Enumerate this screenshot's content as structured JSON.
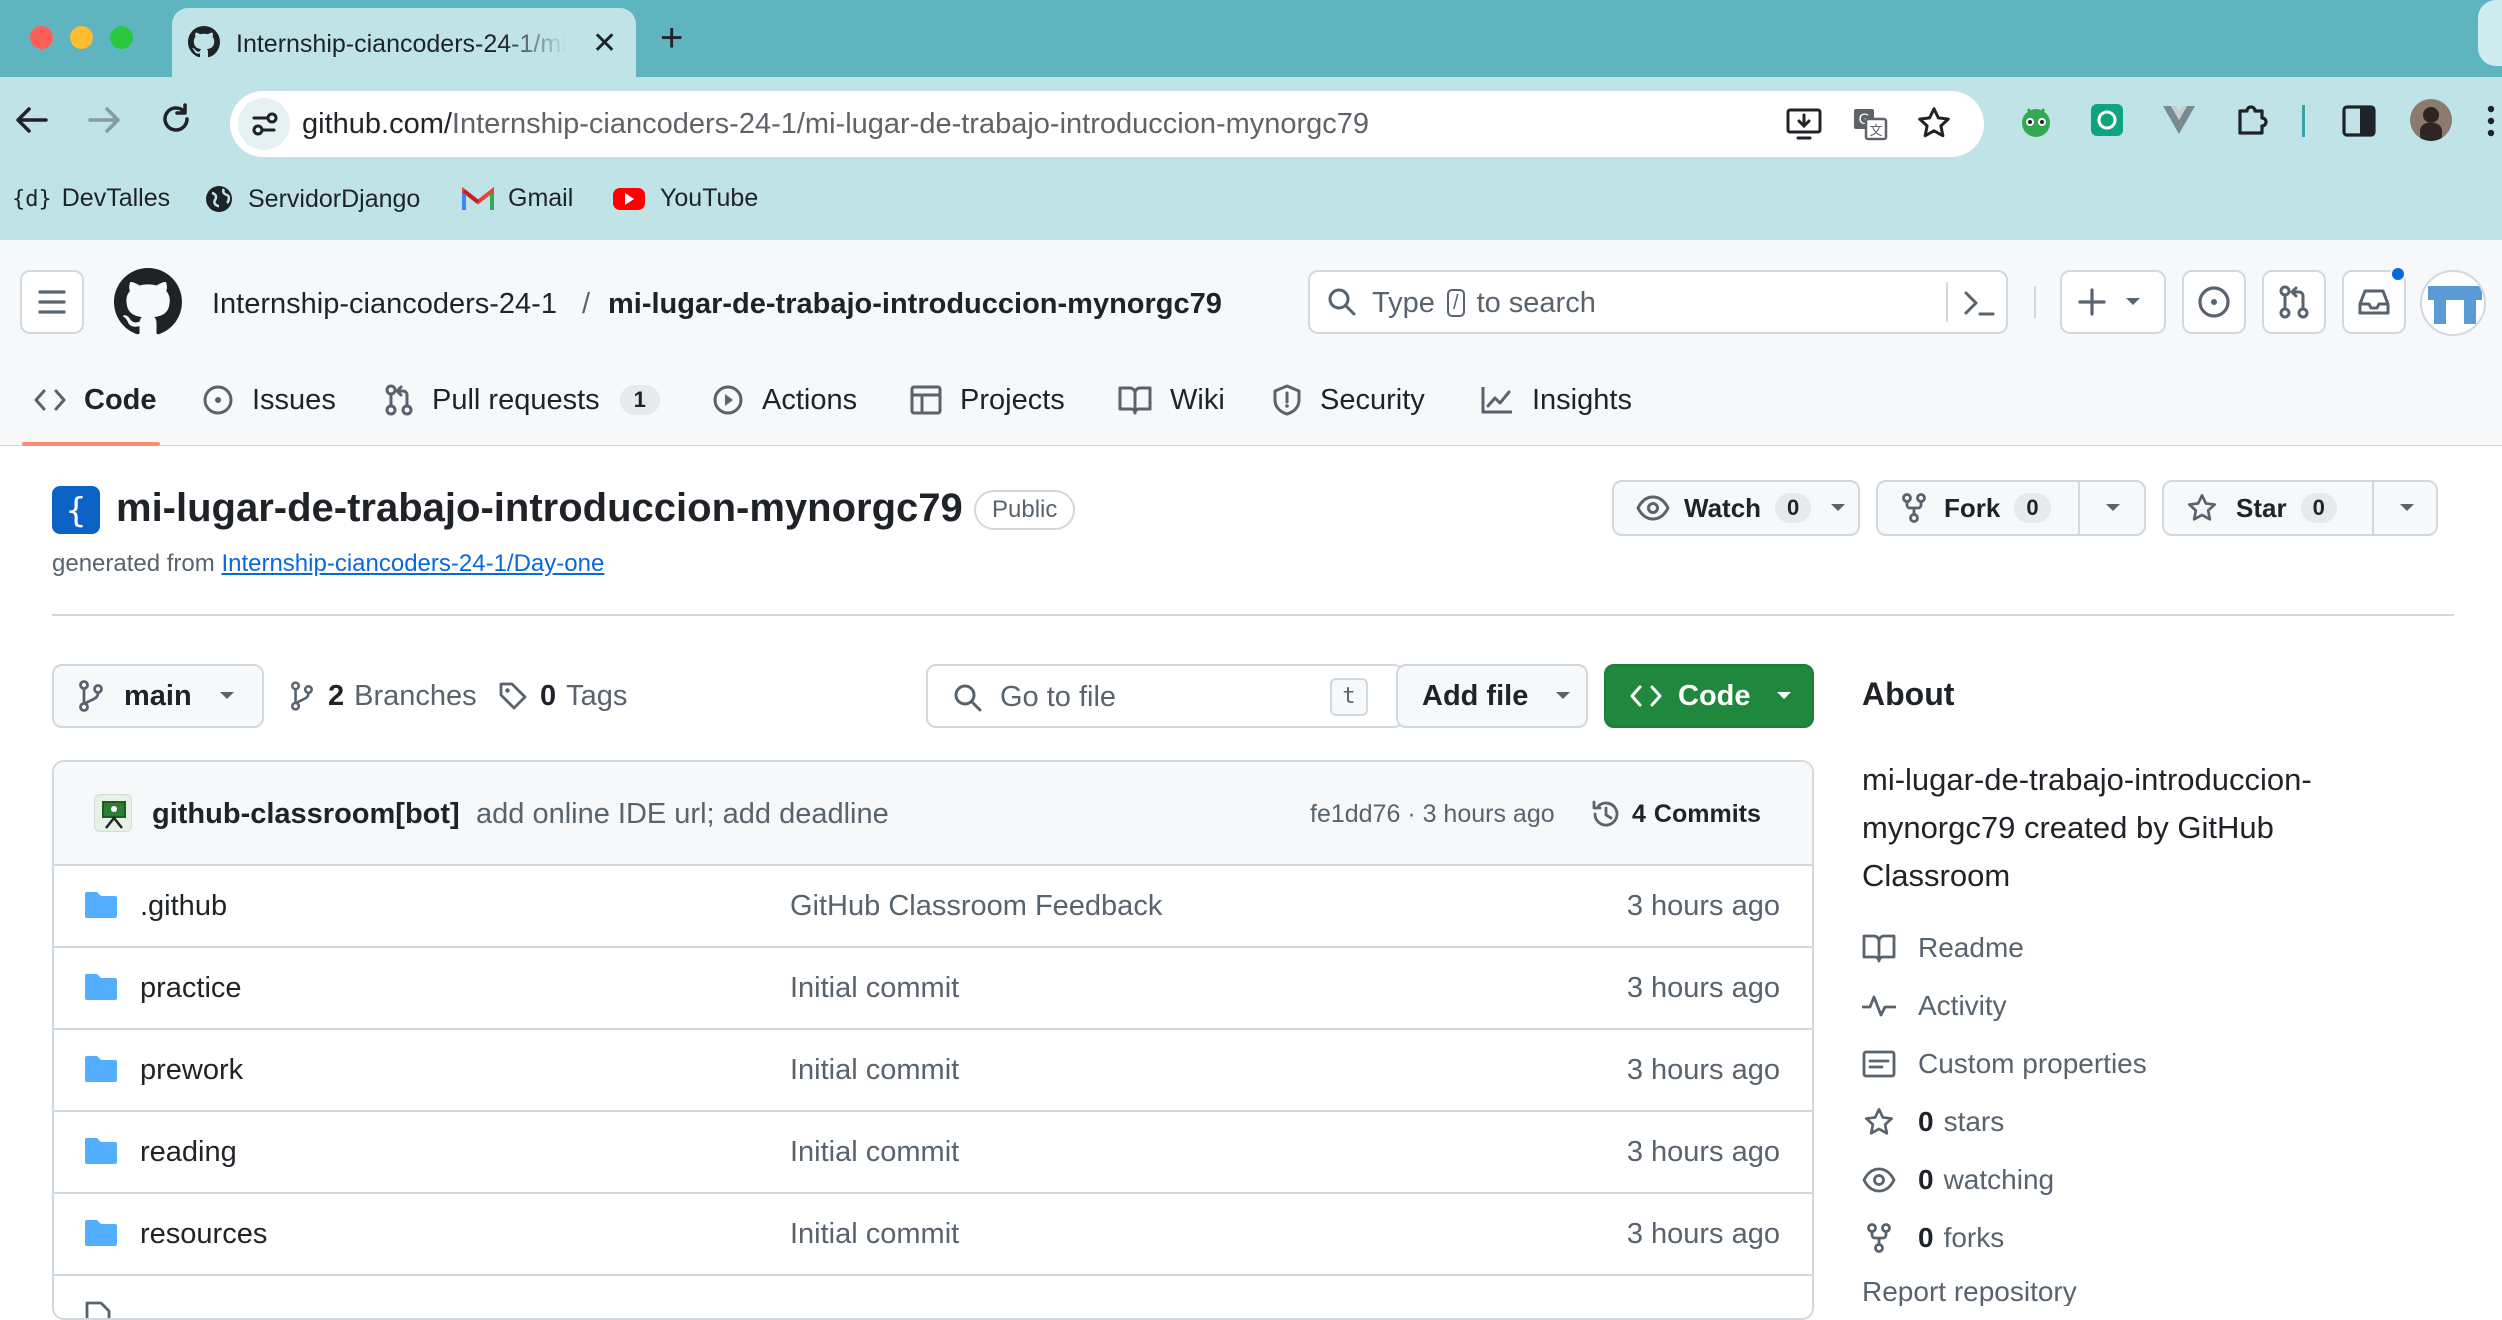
{
  "browser": {
    "tab_title": "Internship-ciancoders-24-1/mi-lugar-de-trabajo-introduccion-mynorgc79",
    "url_host": "github.com/",
    "url_path": "Internship-ciancoders-24-1/mi-lugar-de-trabajo-introduccion-mynorgc79",
    "bookmarks": [
      "DevTalles",
      "ServidorDjango",
      "Gmail",
      "YouTube"
    ]
  },
  "header": {
    "owner": "Internship-ciancoders-24-1",
    "separator": "/",
    "repo": "mi-lugar-de-trabajo-introduccion-mynorgc79",
    "search_pre": "Type",
    "search_key": "/",
    "search_post": "to search"
  },
  "nav": {
    "code": "Code",
    "issues": "Issues",
    "pulls": "Pull requests",
    "pulls_count": "1",
    "actions": "Actions",
    "projects": "Projects",
    "wiki": "Wiki",
    "security": "Security",
    "insights": "Insights"
  },
  "repo": {
    "name": "mi-lugar-de-trabajo-introduccion-mynorgc79",
    "visibility": "Public",
    "generated_prefix": "generated from",
    "template_link": "Internship-ciancoders-24-1/Day-one",
    "watch_label": "Watch",
    "watch_count": "0",
    "fork_label": "Fork",
    "fork_count": "0",
    "star_label": "Star",
    "star_count": "0"
  },
  "files_toolbar": {
    "branch": "main",
    "branches_count": "2",
    "branches_label": "Branches",
    "tags_count": "0",
    "tags_label": "Tags",
    "go_to_file": "Go to file",
    "go_to_file_key": "t",
    "add_file": "Add file",
    "code_button": "Code"
  },
  "latest_commit": {
    "author": "github-classroom[bot]",
    "message": "add online IDE url; add deadline",
    "sha_time": "fe1dd76 · 3 hours ago",
    "commits_count": "4",
    "commits_label": "Commits"
  },
  "files": [
    {
      "name": ".github",
      "message": "GitHub Classroom Feedback",
      "time": "3 hours ago"
    },
    {
      "name": "practice",
      "message": "Initial commit",
      "time": "3 hours ago"
    },
    {
      "name": "prework",
      "message": "Initial commit",
      "time": "3 hours ago"
    },
    {
      "name": "reading",
      "message": "Initial commit",
      "time": "3 hours ago"
    },
    {
      "name": "resources",
      "message": "Initial commit",
      "time": "3 hours ago"
    }
  ],
  "about": {
    "heading": "About",
    "description": "mi-lugar-de-trabajo-introduccion-mynorgc79 created by GitHub Classroom",
    "readme": "Readme",
    "activity": "Activity",
    "custom_properties": "Custom properties",
    "stars_count": "0",
    "stars_label": "stars",
    "watching_count": "0",
    "watching_label": "watching",
    "forks_count": "0",
    "forks_label": "forks",
    "report": "Report repository"
  },
  "colors": {
    "tabbar": "#5fb5bf",
    "toolbar": "#bfe3e7",
    "primary_green": "#1f883d",
    "link_blue": "#0969da",
    "folder_blue": "#54aeff",
    "underline_orange": "#fd8c73"
  }
}
